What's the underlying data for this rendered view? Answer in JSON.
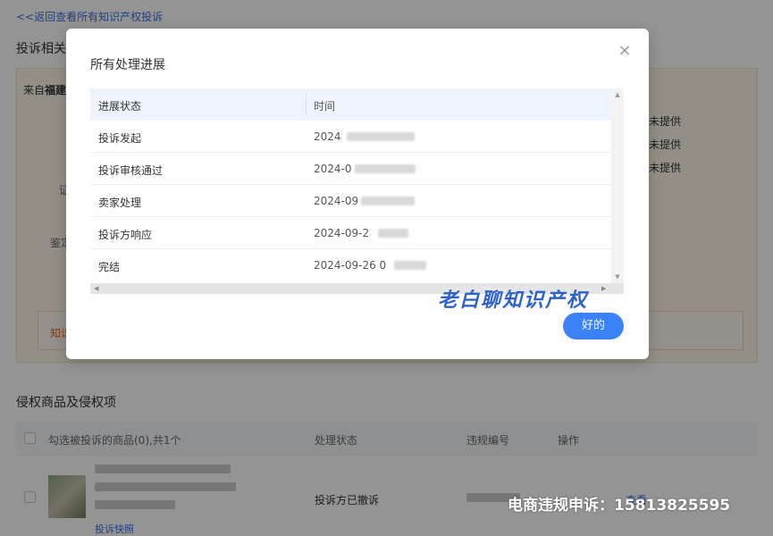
{
  "page": {
    "back_link": "<<返回查看所有知识产权投诉",
    "section1_title": "投诉相关",
    "from_prefix": "来自",
    "from_bold": "福建",
    "not_provided": [
      "未提供",
      "未提供",
      "未提供"
    ],
    "side_labels": [
      "证",
      "鉴定"
    ],
    "warning_text": "知识",
    "section2_title": "侵权商品及侵权项",
    "table_headers": {
      "select_all": "勾选被投诉的商品(0),共1个",
      "status": "处理状态",
      "violation_no": "违规编号",
      "action": "操作"
    },
    "row": {
      "status": "投诉方已撤诉",
      "snapshot": "投诉快照",
      "view": "查看"
    }
  },
  "modal": {
    "title": "所有处理进展",
    "close_symbol": "×",
    "columns": [
      "进展状态",
      "时间"
    ],
    "rows": [
      {
        "status": "投诉发起",
        "time": "2024"
      },
      {
        "status": "投诉审核通过",
        "time": "2024-0"
      },
      {
        "status": "卖家处理",
        "time": "2024-09"
      },
      {
        "status": "投诉方响应",
        "time": "2024-09-2"
      },
      {
        "status": "完结",
        "time": "2024-09-26 0"
      }
    ],
    "ok_button": "好的"
  },
  "watermarks": {
    "blue": "老白聊知识产权",
    "white": "电商违规申诉：15813825595"
  },
  "colors": {
    "accent": "#3b82f6",
    "link": "#3a6fd8",
    "header_bg": "#eef4fd",
    "warning": "#e06a1b"
  }
}
